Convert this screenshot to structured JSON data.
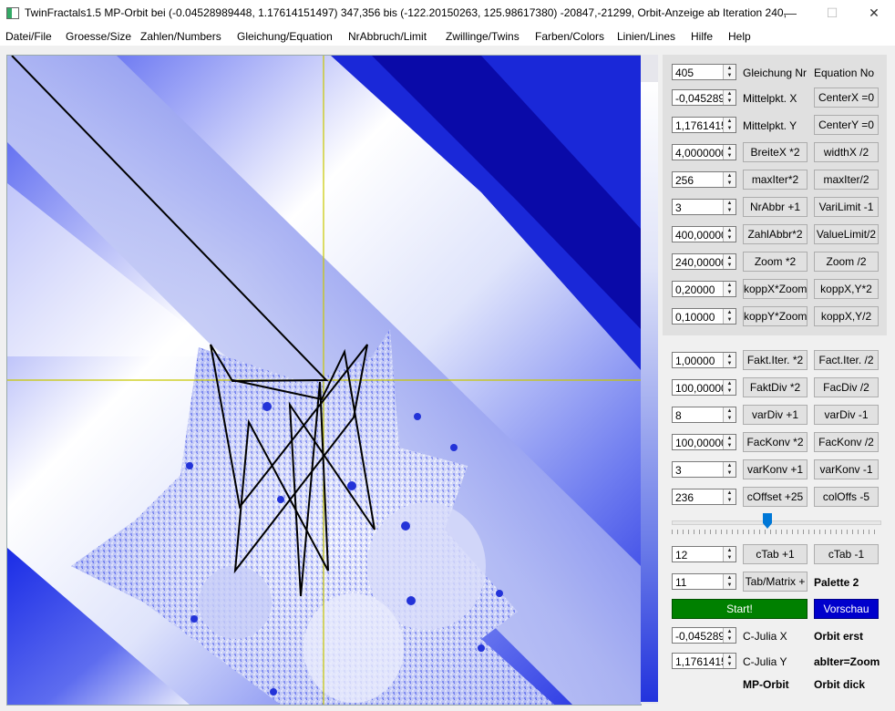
{
  "titlebar": {
    "title": "TwinFractals1.5 MP-Orbit bei (-0.04528989448, 1.17614151497) 347,356 bis (-122.20150263, 125.98617380) -20847,-21299, Orbit-Anzeige ab Iteration 240,",
    "minimize": "—",
    "maximize": "☐",
    "close": "✕"
  },
  "menu": [
    "Datei/File",
    "Groesse/Size",
    "Zahlen/Numbers",
    "Gleichung/Equation",
    "NrAbbruch/Limit",
    "Zwillinge/Twins",
    "Farben/Colors",
    "Linien/Lines",
    "Hilfe",
    "Help"
  ],
  "panel1": {
    "equation": {
      "value": "405",
      "label_de": "Gleichung Nr",
      "label_en": "Equation No"
    },
    "rows": [
      {
        "value": "-0,045289",
        "label": "Mittelpkt. X",
        "button": "CenterX =0"
      },
      {
        "value": "1,1761415",
        "label": "Mittelpkt. Y",
        "button": "CenterY =0"
      },
      {
        "value": "4,0000000",
        "button1": "BreiteX *2",
        "button2": "widthX /2"
      },
      {
        "value": "256",
        "button1": "maxIter*2",
        "button2": "maxIter/2"
      },
      {
        "value": "3",
        "button1": "NrAbbr +1",
        "button2": "VariLimit -1"
      },
      {
        "value": "400,00000",
        "button1": "ZahlAbbr*2",
        "button2": "ValueLimit/2"
      },
      {
        "value": "240,00000",
        "button1": "Zoom *2",
        "button2": "Zoom /2"
      },
      {
        "value": "0,20000",
        "button1": "koppX*Zoom",
        "button2": "koppX,Y*2"
      },
      {
        "value": "0,10000",
        "button1": "koppY*Zoom",
        "button2": "koppX,Y/2"
      }
    ]
  },
  "panel2": {
    "rows": [
      {
        "value": "1,00000",
        "button1": "Fakt.Iter. *2",
        "button2": "Fact.Iter. /2"
      },
      {
        "value": "100,00000",
        "button1": "FaktDiv *2",
        "button2": "FacDiv /2"
      },
      {
        "value": "8",
        "button1": "varDiv +1",
        "button2": "varDiv -1"
      },
      {
        "value": "100,00000",
        "button1": "FacKonv *2",
        "button2": "FacKonv /2"
      },
      {
        "value": "3",
        "button1": "varKonv +1",
        "button2": "varKonv -1"
      },
      {
        "value": "236",
        "button1": "cOffset +25",
        "button2": "colOffs -5"
      }
    ],
    "slider_fraction": 0.46,
    "ctab": {
      "value": "12",
      "button1": "cTab +1",
      "button2": "cTab -1"
    },
    "matrix": {
      "value": "11",
      "button": "Tab/Matrix +",
      "label": "Palette 2"
    },
    "start": "Start!",
    "vorschau": "Vorschau",
    "julia_x": {
      "value": "-0,045289",
      "label": "C-Julia X",
      "label2": "Orbit erst"
    },
    "julia_y": {
      "value": "1,1761415",
      "label": "C-Julia Y",
      "label2": "abIter=Zoom"
    },
    "bottom": {
      "left": "MP-Orbit",
      "right": "Orbit dick"
    }
  },
  "colors": {
    "start": "#008000",
    "vorschau": "#0000cc",
    "crosshair": "#c8c800"
  },
  "icons": {
    "appicon": "twinfractals-app-icon",
    "spin": "spin-arrows-icon",
    "slider": "slider-thumb-icon"
  }
}
